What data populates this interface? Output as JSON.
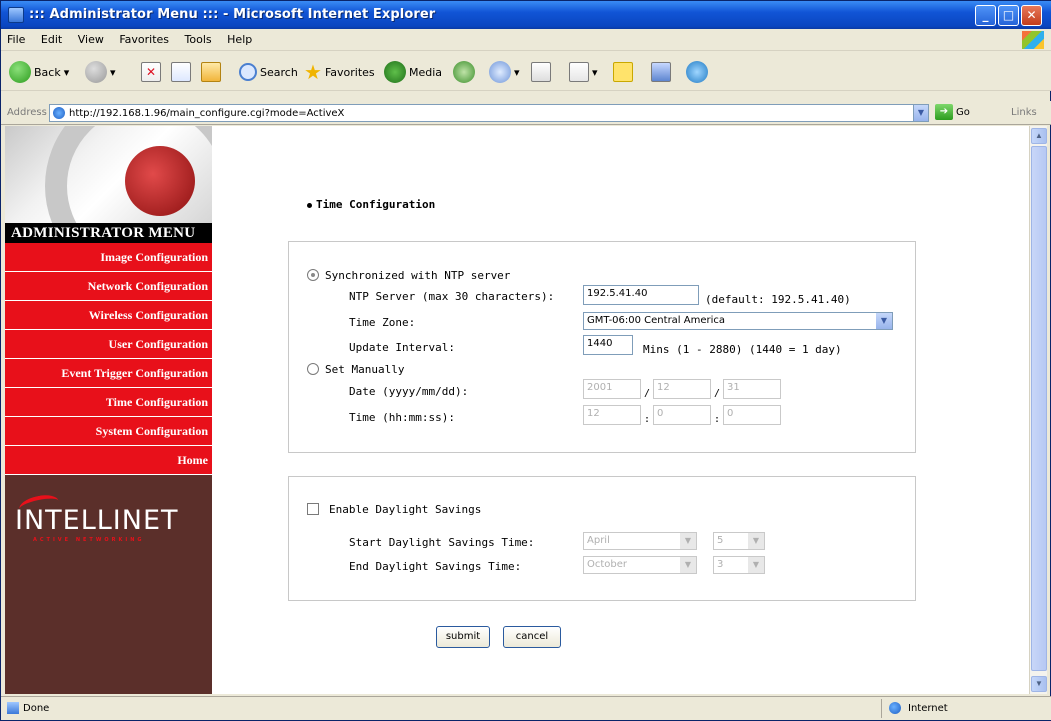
{
  "window": {
    "title": "::: Administrator Menu ::: - Microsoft Internet Explorer"
  },
  "menubar": {
    "items": [
      "File",
      "Edit",
      "View",
      "Favorites",
      "Tools",
      "Help"
    ]
  },
  "toolbar": {
    "back_label": "Back",
    "search_label": "Search",
    "favorites_label": "Favorites",
    "media_label": "Media"
  },
  "address": {
    "label": "Address",
    "url": "http://192.168.1.96/main_configure.cgi?mode=ActiveX",
    "go_label": "Go",
    "links_label": "Links"
  },
  "sidebar": {
    "title": "ADMINISTRATOR MENU",
    "items": [
      "Image Configuration",
      "Network Configuration",
      "Wireless Configuration",
      "User Configuration",
      "Event Trigger Configuration",
      "Time Configuration",
      "System Configuration",
      "Home"
    ],
    "brand": "INTELLINET",
    "tagline": "ACTIVE NETWORKING",
    "accent_color": "#e8101a",
    "panel_color": "#5b2f2a"
  },
  "main": {
    "section_title": "Time Configuration",
    "ntp": {
      "radio_label": "Synchronized with NTP server",
      "server_label": "NTP Server (max 30 characters):",
      "server_value": "192.5.41.40",
      "server_default": "(default: 192.5.41.40)",
      "timezone_label": "Time Zone:",
      "timezone_value": "GMT-06:00 Central America",
      "interval_label": "Update Interval:",
      "interval_value": "1440",
      "interval_hint": "Mins (1 - 2880) (1440 = 1 day)"
    },
    "manual": {
      "radio_label": "Set Manually",
      "date_label": "Date (yyyy/mm/dd):",
      "date_year": "2001",
      "date_month": "12",
      "date_day": "31",
      "time_label": "Time (hh:mm:ss):",
      "time_hour": "12",
      "time_min": "0",
      "time_sec": "0"
    },
    "dst": {
      "checkbox_label": "Enable Daylight Savings",
      "start_label": "Start Daylight Savings Time:",
      "start_month": "April",
      "start_week": "5",
      "end_label": "End Daylight Savings Time:",
      "end_month": "October",
      "end_week": "3"
    },
    "submit_label": "submit",
    "cancel_label": "cancel"
  },
  "statusbar": {
    "status": "Done",
    "zone": "Internet"
  }
}
